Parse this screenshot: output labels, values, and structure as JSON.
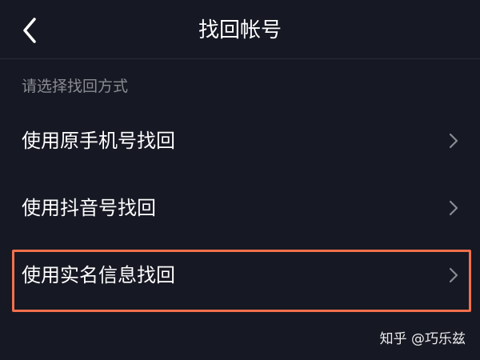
{
  "colors": {
    "background": "#161823",
    "highlight": "#f2704d",
    "hint_text": "#8a8b91"
  },
  "nav": {
    "back_icon": "chevron-left-icon",
    "title": "找回帐号"
  },
  "section_hint": "请选择找回方式",
  "options": [
    {
      "label": "使用原手机号找回",
      "icon": "chevron-right-icon"
    },
    {
      "label": "使用抖音号找回",
      "icon": "chevron-right-icon"
    },
    {
      "label": "使用实名信息找回",
      "icon": "chevron-right-icon",
      "highlighted": true
    }
  ],
  "watermark": "知乎 @巧乐兹"
}
